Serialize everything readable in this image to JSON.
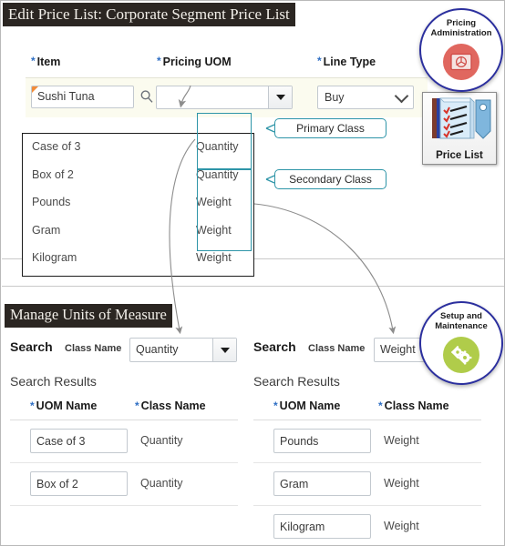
{
  "window": {
    "upper_title": "Edit Price List: Corporate Segment Price List",
    "lower_title": "Manage Units of Measure"
  },
  "colors": {
    "title_bar_bg": "#2b2622",
    "required_star": "#2f6fc4",
    "callout_border": "#2e95a8",
    "group_box_border": "#2e95a8",
    "badge_ring": "#2b2f9e",
    "pricing_badge_fill": "#e0675f",
    "setup_badge_fill": "#b0cc4a",
    "form_row_bg": "#fbfbef",
    "required_corner": "#f28b38"
  },
  "price_list_form": {
    "labels": {
      "item": "Item",
      "pricing_uom": "Pricing UOM",
      "line_type": "Line Type"
    },
    "item_value": "Sushi Tuna",
    "item_placeholder": "",
    "pricing_uom_value": "",
    "line_type_value": "Buy"
  },
  "uom_popup": {
    "rows": [
      {
        "name": "Case of 3",
        "class": "Quantity"
      },
      {
        "name": "Box of 2",
        "class": "Quantity"
      },
      {
        "name": "Pounds",
        "class": "Weight"
      },
      {
        "name": "Gram",
        "class": "Weight"
      },
      {
        "name": "Kilogram",
        "class": "Weight"
      }
    ]
  },
  "callouts": {
    "primary": "Primary Class",
    "secondary": "Secondary Class"
  },
  "badges": {
    "pricing": "Pricing\nAdministration",
    "setup": "Setup and\nMaintenance",
    "price_list_icon_label": "Price List"
  },
  "manage_uom": {
    "left": {
      "search_label": "Search",
      "class_name_label": "Class Name",
      "class_name_value": "Quantity",
      "results_label": "Search Results",
      "columns": {
        "uom_name": "UOM Name",
        "class_name": "Class Name"
      },
      "rows": [
        {
          "uom_name": "Case of 3",
          "class_name": "Quantity"
        },
        {
          "uom_name": "Box of 2",
          "class_name": "Quantity"
        }
      ]
    },
    "right": {
      "search_label": "Search",
      "class_name_label": "Class Name",
      "class_name_value": "Weight",
      "results_label": "Search Results",
      "columns": {
        "uom_name": "UOM Name",
        "class_name": "Class Name"
      },
      "rows": [
        {
          "uom_name": "Pounds",
          "class_name": "Weight"
        },
        {
          "uom_name": "Gram",
          "class_name": "Weight"
        },
        {
          "uom_name": "Kilogram",
          "class_name": "Weight"
        }
      ]
    }
  }
}
